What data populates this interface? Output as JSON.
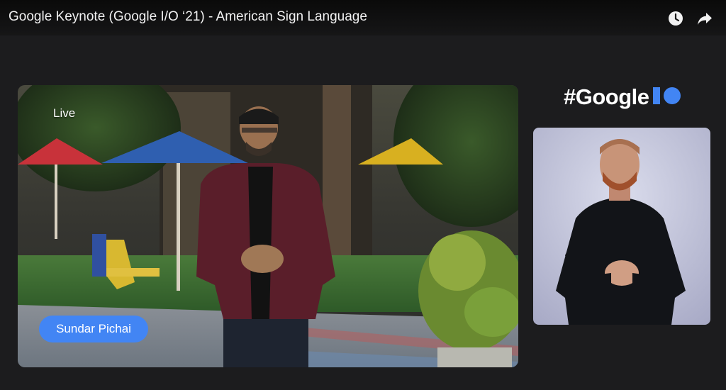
{
  "header": {
    "title": "Google Keynote (Google I/O ‘21) - American Sign Language",
    "watch_later_icon": "clock-icon",
    "share_icon": "share-arrow-icon"
  },
  "main_video": {
    "live_label": "Live",
    "speaker_name": "Sundar Pichai",
    "chip_color": "#4285f4"
  },
  "branding": {
    "hashtag_text": "#Google",
    "io_icon": "io-logo-icon",
    "io_color": "#4285f4"
  },
  "interpreter_video": {
    "background_color": "#c9cbe0"
  }
}
